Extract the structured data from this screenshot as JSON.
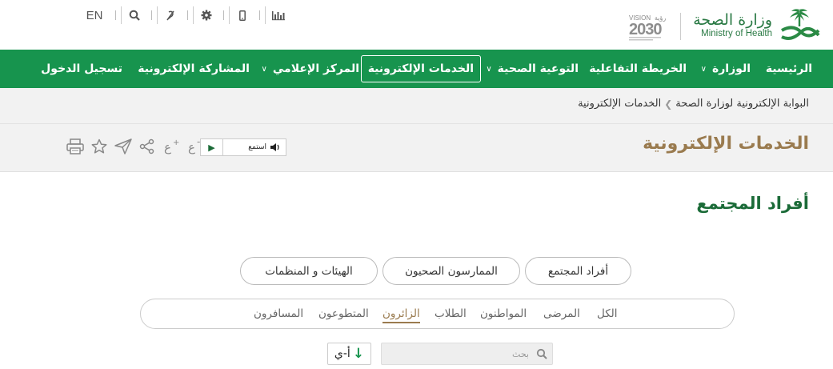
{
  "top": {
    "lang": "EN",
    "tools": [
      "stats-icon",
      "mobile-icon",
      "settings-icon",
      "accessibility-icon",
      "search-icon"
    ]
  },
  "logo": {
    "ar": "وزارة الصحة",
    "en": "Ministry of Health",
    "vision": "2030"
  },
  "nav": {
    "items": [
      {
        "label": "الرئيسية"
      },
      {
        "label": "الوزارة"
      },
      {
        "label": "الخريطة التفاعلية"
      },
      {
        "label": "التوعية الصحية"
      },
      {
        "label": "الخدمات الإلكترونية"
      },
      {
        "label": "المركز الإعلامي"
      },
      {
        "label": "المشاركة الإلكترونية"
      },
      {
        "label": "تسجيل الدخول"
      }
    ]
  },
  "breadcrumb": {
    "home": "البوابة الإلكترونية لوزارة الصحة",
    "current": "الخدمات الإلكترونية"
  },
  "page": {
    "title": "الخدمات الإلكترونية",
    "listen": "استمع"
  },
  "section": {
    "title": "أفراد المجتمع"
  },
  "tabs": [
    {
      "label": "أفراد المجتمع"
    },
    {
      "label": "الممارسون الصحيون"
    },
    {
      "label": "الهيئات و المنظمات"
    }
  ],
  "filters": [
    {
      "label": "الكل"
    },
    {
      "label": "المرضى"
    },
    {
      "label": "المواطنون"
    },
    {
      "label": "الطلاب"
    },
    {
      "label": "الزائرون"
    },
    {
      "label": "المتطوعون"
    },
    {
      "label": "المسافرون"
    }
  ],
  "search": {
    "placeholder": "بحث"
  },
  "sort": {
    "label": "أ-ي"
  },
  "colors": {
    "green": "#17944e",
    "gold": "#9a7b4f",
    "dark_green": "#1b6b38"
  }
}
